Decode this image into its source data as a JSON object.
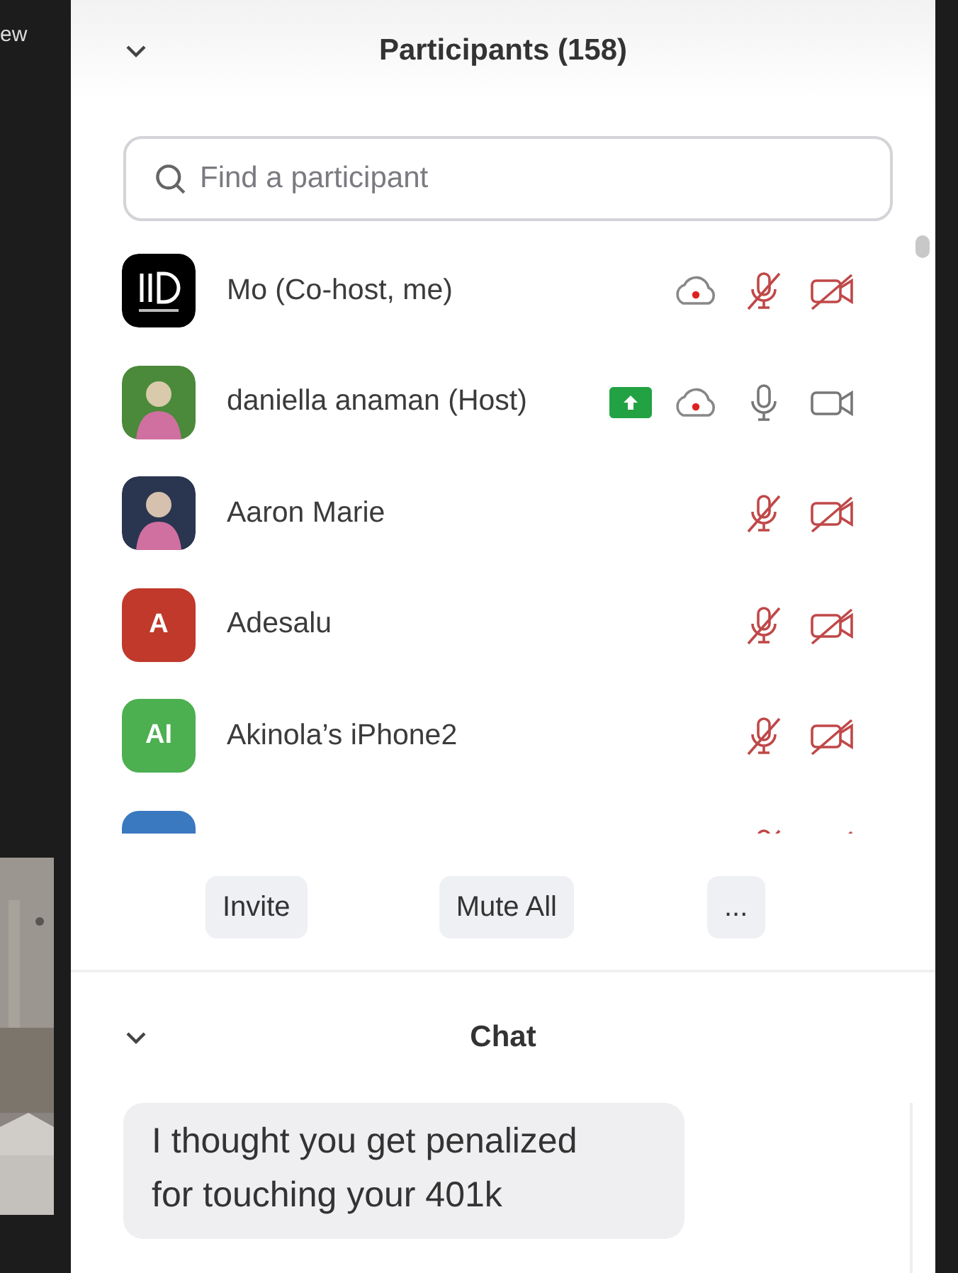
{
  "background": {
    "corner_text": "ew",
    "kind": "picture"
  },
  "participants": {
    "title": "Participants (158)",
    "expanded": true,
    "search": {
      "placeholder": "Find a participant"
    },
    "rows": [
      {
        "name": "Mo (Co-host, me)",
        "avatar": {
          "kind": "logo"
        },
        "sharing": false,
        "recording": true,
        "mic_muted": true,
        "video_off": true
      },
      {
        "name": "daniella anaman (Host)",
        "sharing": true,
        "recording": true,
        "mic_muted": false,
        "video_off": false
      },
      {
        "name": "Aaron Marie",
        "sharing": false,
        "recording": false,
        "mic_muted": true,
        "video_off": true
      },
      {
        "name": "Adesalu",
        "avatar": {
          "kind": "initials",
          "initials": "A",
          "color": "#c0392b"
        },
        "sharing": false,
        "recording": false,
        "mic_muted": true,
        "video_off": true
      },
      {
        "name": "Akinola’s iPhone2",
        "avatar": {
          "kind": "initials",
          "initials": "AI",
          "color": "#4caf50"
        },
        "sharing": false,
        "recording": false,
        "mic_muted": true,
        "video_off": true
      },
      {
        "avatar": {
          "kind": "initials",
          "color": "#3a78c0"
        },
        "sharing": false,
        "recording": false,
        "mic_muted": true,
        "video_off": true
      }
    ],
    "buttons": [
      "Invite",
      "Mute All",
      "..."
    ]
  },
  "chat": {
    "title": "Chat",
    "expanded": true,
    "messages": [
      "I thought you get penalized for touching your 401k"
    ]
  }
}
